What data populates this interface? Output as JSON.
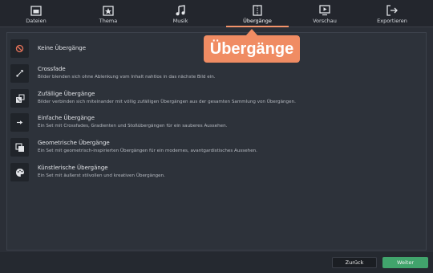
{
  "tabs": [
    {
      "label": "Dateien",
      "icon": "folder-icon",
      "active": false
    },
    {
      "label": "Thema",
      "icon": "theme-icon",
      "active": false
    },
    {
      "label": "Musik",
      "icon": "music-icon",
      "active": false
    },
    {
      "label": "Übergänge",
      "icon": "transitions-icon",
      "active": true
    },
    {
      "label": "Vorschau",
      "icon": "preview-icon",
      "active": false
    },
    {
      "label": "Exportieren",
      "icon": "export-icon",
      "active": false
    }
  ],
  "callout": {
    "text": "Übergänge"
  },
  "options": [
    {
      "title": "Keine Übergänge",
      "description": "",
      "icon": "none-icon"
    },
    {
      "title": "Crossfade",
      "description": "Bilder blenden sich ohne Ablenkung vom Inhalt nahtlos in das nächste Bild ein.",
      "icon": "crossfade-icon"
    },
    {
      "title": "Zufällige Übergänge",
      "description": "Bilder verbinden sich miteinander mit völlig zufälligen Übergängen aus der gesamten Sammlung von Übergängen.",
      "icon": "dice-icon"
    },
    {
      "title": "Einfache Übergänge",
      "description": "Ein Set mit Crossfades, Gradienten und Stoßübergängen für ein sauberes Aussehen.",
      "icon": "arrow-right-icon"
    },
    {
      "title": "Geometrische Übergänge",
      "description": "Ein Set mit geometrisch-inspirierten Übergängen für ein modernes, avantgardistisches Aussehen.",
      "icon": "squares-icon"
    },
    {
      "title": "Künstlerische Übergänge",
      "description": "Ein Set mit äußerst stilvollen und kreativen Übergängen.",
      "icon": "palette-icon"
    }
  ],
  "footer": {
    "back_label": "Zurück",
    "next_label": "Weiter"
  },
  "colors": {
    "accent": "#f08c63",
    "next_button": "#41a46c",
    "background": "#2b2f37"
  }
}
